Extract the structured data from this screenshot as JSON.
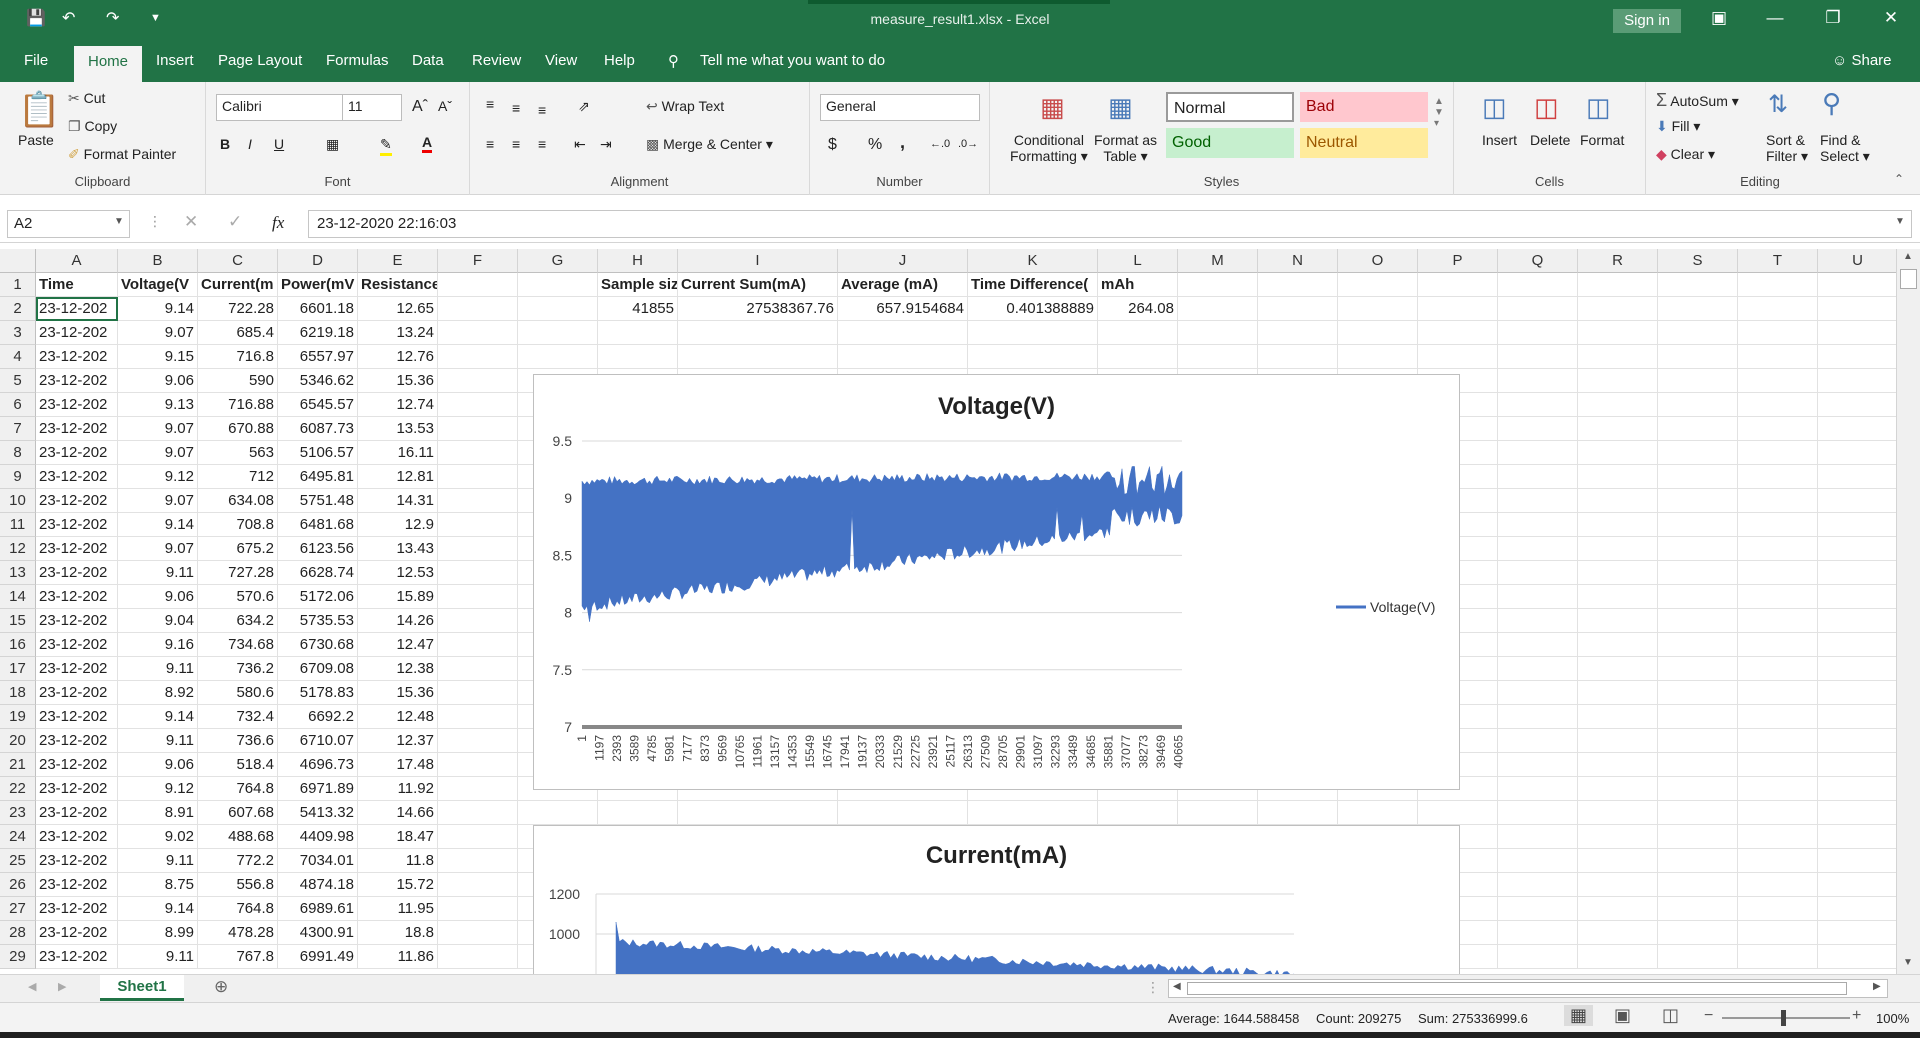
{
  "window": {
    "title": "measure_result1.xlsx  -  Excel",
    "sign_in": "Sign in",
    "share": "Share"
  },
  "tabs": [
    "File",
    "Home",
    "Insert",
    "Page Layout",
    "Formulas",
    "Data",
    "Review",
    "View",
    "Help"
  ],
  "tell_me": "Tell me what you want to do",
  "ribbon": {
    "clipboard": {
      "label": "Clipboard",
      "paste": "Paste",
      "cut": "Cut",
      "copy": "Copy",
      "format_painter": "Format Painter"
    },
    "font": {
      "label": "Font",
      "name": "Calibri",
      "size": "11",
      "bold": "B",
      "italic": "I",
      "underline": "U"
    },
    "alignment": {
      "label": "Alignment",
      "wrap_text": "Wrap Text",
      "merge_center": "Merge & Center"
    },
    "number": {
      "label": "Number",
      "format": "General",
      "currency": "$",
      "percent": "%",
      "comma": ","
    },
    "styles": {
      "label": "Styles",
      "conditional_1": "Conditional",
      "conditional_2": "Formatting",
      "format_as_1": "Format as",
      "format_as_2": "Table",
      "normal": "Normal",
      "bad": "Bad",
      "good": "Good",
      "neutral": "Neutral"
    },
    "cells": {
      "label": "Cells",
      "insert": "Insert",
      "delete": "Delete",
      "format": "Format"
    },
    "editing": {
      "label": "Editing",
      "autosum": "AutoSum",
      "fill": "Fill",
      "clear": "Clear",
      "sort_1": "Sort &",
      "sort_2": "Filter",
      "find_1": "Find &",
      "find_2": "Select"
    }
  },
  "formula_bar": {
    "name_box": "A2",
    "fx": "fx",
    "content": "23-12-2020 22:16:03"
  },
  "columns": [
    "A",
    "B",
    "C",
    "D",
    "E",
    "F",
    "G",
    "H",
    "I",
    "J",
    "K",
    "L",
    "M",
    "N",
    "O",
    "P",
    "Q",
    "R",
    "S",
    "T",
    "U"
  ],
  "headers": [
    "Time",
    "Voltage(V",
    "Current(m",
    "Power(mV",
    "Resistance"
  ],
  "rows": [
    [
      "23-12-202",
      "9.14",
      "722.28",
      "6601.18",
      "12.65"
    ],
    [
      "23-12-202",
      "9.07",
      "685.4",
      "6219.18",
      "13.24"
    ],
    [
      "23-12-202",
      "9.15",
      "716.8",
      "6557.97",
      "12.76"
    ],
    [
      "23-12-202",
      "9.06",
      "590",
      "5346.62",
      "15.36"
    ],
    [
      "23-12-202",
      "9.13",
      "716.88",
      "6545.57",
      "12.74"
    ],
    [
      "23-12-202",
      "9.07",
      "670.88",
      "6087.73",
      "13.53"
    ],
    [
      "23-12-202",
      "9.07",
      "563",
      "5106.57",
      "16.11"
    ],
    [
      "23-12-202",
      "9.12",
      "712",
      "6495.81",
      "12.81"
    ],
    [
      "23-12-202",
      "9.07",
      "634.08",
      "5751.48",
      "14.31"
    ],
    [
      "23-12-202",
      "9.14",
      "708.8",
      "6481.68",
      "12.9"
    ],
    [
      "23-12-202",
      "9.07",
      "675.2",
      "6123.56",
      "13.43"
    ],
    [
      "23-12-202",
      "9.11",
      "727.28",
      "6628.74",
      "12.53"
    ],
    [
      "23-12-202",
      "9.06",
      "570.6",
      "5172.06",
      "15.89"
    ],
    [
      "23-12-202",
      "9.04",
      "634.2",
      "5735.53",
      "14.26"
    ],
    [
      "23-12-202",
      "9.16",
      "734.68",
      "6730.68",
      "12.47"
    ],
    [
      "23-12-202",
      "9.11",
      "736.2",
      "6709.08",
      "12.38"
    ],
    [
      "23-12-202",
      "8.92",
      "580.6",
      "5178.83",
      "15.36"
    ],
    [
      "23-12-202",
      "9.14",
      "732.4",
      "6692.2",
      "12.48"
    ],
    [
      "23-12-202",
      "9.11",
      "736.6",
      "6710.07",
      "12.37"
    ],
    [
      "23-12-202",
      "9.06",
      "518.4",
      "4696.73",
      "17.48"
    ],
    [
      "23-12-202",
      "9.12",
      "764.8",
      "6971.89",
      "11.92"
    ],
    [
      "23-12-202",
      "8.91",
      "607.68",
      "5413.32",
      "14.66"
    ],
    [
      "23-12-202",
      "9.02",
      "488.68",
      "4409.98",
      "18.47"
    ],
    [
      "23-12-202",
      "9.11",
      "772.2",
      "7034.01",
      "11.8"
    ],
    [
      "23-12-202",
      "8.75",
      "556.8",
      "4874.18",
      "15.72"
    ],
    [
      "23-12-202",
      "9.14",
      "764.8",
      "6989.61",
      "11.95"
    ],
    [
      "23-12-202",
      "8.99",
      "478.28",
      "4300.91",
      "18.8"
    ],
    [
      "23-12-202",
      "9.11",
      "767.8",
      "6991.49",
      "11.86"
    ]
  ],
  "summary_headers": [
    "Sample siz",
    "Current Sum(mA)",
    "Average (mA)",
    "Time Difference(",
    "mAh"
  ],
  "summary_values": [
    "41855",
    "27538367.76",
    "657.9154684",
    "0.401388889",
    "264.08"
  ],
  "chart_data": [
    {
      "type": "area",
      "title": "Voltage(V)",
      "legend": "right",
      "ylim": [
        7,
        9.5
      ],
      "yticks": [
        "9.5",
        "9",
        "8.5",
        "8",
        "7.5",
        "7"
      ],
      "xticks": [
        "1",
        "1197",
        "2393",
        "3589",
        "4785",
        "5981",
        "7177",
        "8373",
        "9569",
        "10765",
        "11961",
        "13157",
        "14353",
        "15549",
        "16745",
        "17941",
        "19137",
        "20333",
        "21529",
        "22725",
        "23921",
        "25117",
        "26313",
        "27509",
        "28705",
        "29901",
        "31097",
        "32293",
        "33489",
        "34685",
        "35881",
        "37077",
        "38273",
        "39469",
        "40665"
      ],
      "series": [
        {
          "name": "Voltage(V)",
          "color": "#4472c4",
          "upper_start": 9.15,
          "upper_end": 9.2,
          "lower_start": 8.05,
          "lower_end": 8.8,
          "min": 7.92,
          "max": 9.28
        }
      ],
      "grid": true
    },
    {
      "type": "area",
      "title": "Current(mA)",
      "ylim": [
        0,
        1200
      ],
      "yticks": [
        "1200",
        "1000"
      ],
      "series": [
        {
          "name": "Current(mA)",
          "color": "#4472c4",
          "peak": 1060,
          "upper_start": 960,
          "upper_end": 800
        }
      ],
      "grid": true
    }
  ],
  "sheet_tab": "Sheet1",
  "status": {
    "average": "Average: 1644.588458",
    "count": "Count: 209275",
    "sum": "Sum: 275336999.6",
    "zoom": "100%"
  }
}
